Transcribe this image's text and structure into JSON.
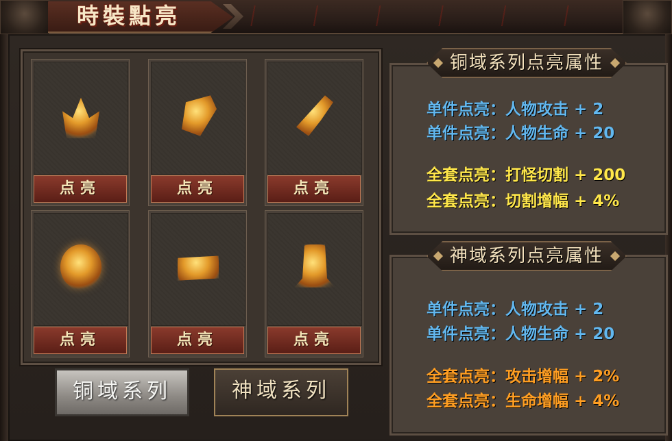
{
  "title": "時裝點亮",
  "slots": [
    {
      "icon": "crown-icon",
      "button": "点亮"
    },
    {
      "icon": "shoulder-armor-icon",
      "button": "点亮"
    },
    {
      "icon": "gauntlet-icon",
      "button": "点亮"
    },
    {
      "icon": "ring-icon",
      "button": "点亮"
    },
    {
      "icon": "belt-icon",
      "button": "点亮"
    },
    {
      "icon": "boots-icon",
      "button": "点亮"
    }
  ],
  "series_tabs": [
    {
      "label": "铜域系列",
      "active": true
    },
    {
      "label": "神域系列",
      "active": false
    }
  ],
  "attributes": [
    {
      "header": "铜域系列点亮属性",
      "lines": [
        {
          "text": "单件点亮：人物攻击 + 2",
          "color": "#62b8f0"
        },
        {
          "text": "单件点亮：人物生命 + 20",
          "color": "#62b8f0"
        },
        {
          "text": "全套点亮：打怪切割 + 200",
          "color": "#ffe74a"
        },
        {
          "text": "全套点亮：切割增幅 + 4%",
          "color": "#ffe74a"
        }
      ]
    },
    {
      "header": "神域系列点亮属性",
      "lines": [
        {
          "text": "单件点亮：人物攻击 + 2",
          "color": "#62b8f0"
        },
        {
          "text": "单件点亮：人物生命 + 20",
          "color": "#62b8f0"
        },
        {
          "text": "全套点亮：攻击增幅 + 2%",
          "color": "#ff9e22"
        },
        {
          "text": "全套点亮：生命增幅 + 4%",
          "color": "#ff9e22"
        }
      ]
    }
  ]
}
